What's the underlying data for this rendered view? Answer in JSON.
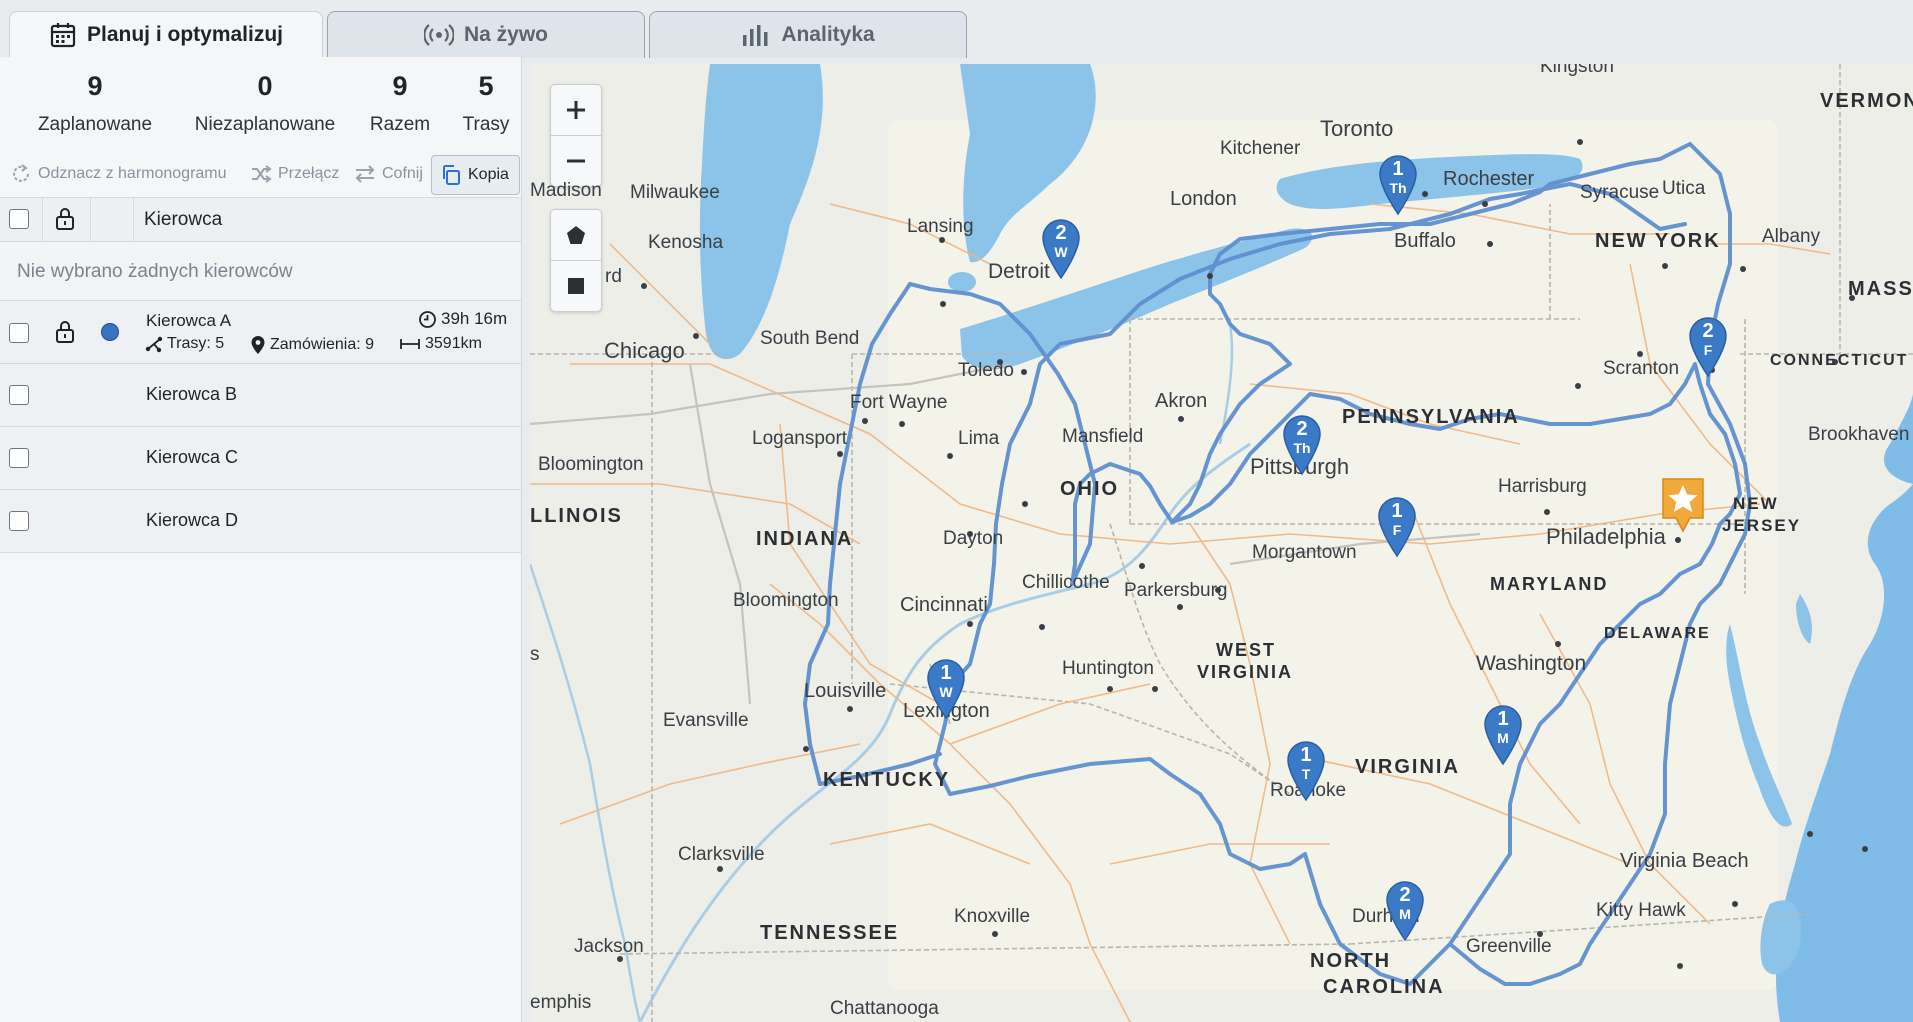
{
  "tabs": [
    {
      "label": "Planuj i optymalizuj",
      "icon": "calendar-icon",
      "active": true
    },
    {
      "label": "Na żywo",
      "icon": "broadcast-icon",
      "active": false
    },
    {
      "label": "Analityka",
      "icon": "bar-chart-icon",
      "active": false
    }
  ],
  "stats": [
    {
      "value": "9",
      "label": "Zaplanowane"
    },
    {
      "value": "0",
      "label": "Niezaplanowane"
    },
    {
      "value": "9",
      "label": "Razem"
    },
    {
      "value": "5",
      "label": "Trasy"
    }
  ],
  "actions": {
    "unschedule": "Odznacz z harmonogramu",
    "switch": "Przełącz",
    "undo": "Cofnij",
    "copy": "Kopia"
  },
  "table": {
    "header": "Kierowca",
    "empty_message": "Nie wybrano żadnych kierowców",
    "driver_a": {
      "name": "Kierowca A",
      "duration": "39h 16m",
      "routes": "Trasy: 5",
      "orders": "Zamówienia: 9",
      "distance": "3591km",
      "color": "#3a72c4"
    },
    "drivers": [
      "Kierowca B",
      "Kierowca C",
      "Kierowca D"
    ]
  },
  "map": {
    "cities": {
      "kingston": "Kingston",
      "toronto": "Toronto",
      "kitchener": "Kitchener",
      "rochester": "Rochester",
      "syracuse": "Syracuse",
      "utica": "Utica",
      "albany": "Albany",
      "madison": "Madison",
      "milwaukee": "Milwaukee",
      "london": "London",
      "lansing": "Lansing",
      "kenosha": "Kenosha",
      "buffalo": "Buffalo",
      "detroit": "Detroit",
      "chicago": "Chicago",
      "south_bend": "South Bend",
      "scranton": "Scranton",
      "toledo": "Toledo",
      "fort_wayne": "Fort Wayne",
      "akron": "Akron",
      "brookhaven": "Brookhaven",
      "lima": "Lima",
      "mansfield": "Mansfield",
      "logansport": "Logansport",
      "pittsburgh": "Pittsburgh",
      "bloomington_il": "Bloomington",
      "harrisburg": "Harrisburg",
      "philadelphia": "Philadelphia",
      "dayton": "Dayton",
      "morgantown": "Morgantown",
      "chillicothe": "Chillicothe",
      "parkersburg": "Parkersburg",
      "bloomington_in": "Bloomington",
      "cincinnati": "Cincinnati",
      "washington": "Washington",
      "huntington": "Huntington",
      "louisville": "Louisville",
      "evansville": "Evansville",
      "lexington": "Lexington",
      "roanoke": "Roanoke",
      "virginia_beach": "Virginia Beach",
      "clarksville": "Clarksville",
      "kitty_hawk": "Kitty Hawk",
      "knoxville": "Knoxville",
      "durham": "Durham",
      "greenville": "Greenville",
      "jackson": "Jackson",
      "memphis": "emphis",
      "chattanooga": "Chattanooga",
      "rd": "rd",
      "s": "s"
    },
    "states": {
      "vermont": "VERMON",
      "new_york": "NEW YORK",
      "massachusetts": "MASSA",
      "connecticut": "CONNECTICUT",
      "pennsylvania": "PENNSYLVANIA",
      "ohio": "OHIO",
      "illinois": "LLINOIS",
      "indiana": "INDIANA",
      "new_jersey_1": "NEW",
      "new_jersey_2": "JERSEY",
      "maryland": "MARYLAND",
      "delaware": "DELAWARE",
      "west_virginia_1": "WEST",
      "west_virginia_2": "VIRGINIA",
      "kentucky": "KENTUCKY",
      "virginia": "VIRGINIA",
      "tennessee": "TENNESSEE",
      "north_carolina_1": "NORTH",
      "north_carolina_2": "CAROLINA"
    },
    "stops": [
      {
        "num": "1",
        "day": "Th"
      },
      {
        "num": "2",
        "day": "W"
      },
      {
        "num": "2",
        "day": "F"
      },
      {
        "num": "2",
        "day": "Th"
      },
      {
        "num": "1",
        "day": "F"
      },
      {
        "num": "1",
        "day": "W"
      },
      {
        "num": "1",
        "day": "T"
      },
      {
        "num": "1",
        "day": "M"
      },
      {
        "num": "2",
        "day": "M"
      }
    ],
    "route_color": "#5e8fcf",
    "pin_color": "#3b7ac7",
    "depot_color": "#f2a93b"
  }
}
